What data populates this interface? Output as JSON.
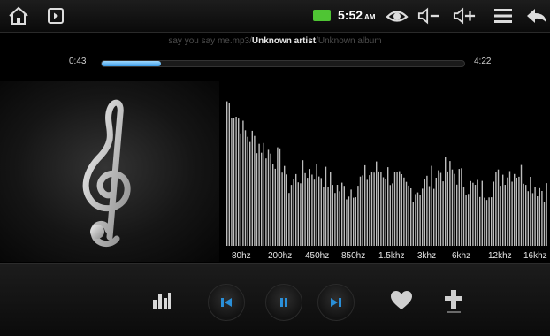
{
  "status_bar": {
    "time": "5:52",
    "ampm": "AM",
    "icons": [
      "home-icon",
      "play-indicator-icon",
      "battery-icon",
      "eye-icon",
      "volume-down-icon",
      "volume-up-icon",
      "menu-icon",
      "back-icon"
    ],
    "battery_color": "#4fc534"
  },
  "now_playing": {
    "title": "say you say me.mp3",
    "separator": "/",
    "artist": "Unknown artist",
    "album": "Unknown album",
    "elapsed": "0:43",
    "duration": "4:22",
    "progress_fraction": 0.164,
    "progress_color": "#3a9be6"
  },
  "album_art": {
    "icon": "treble-clef-icon"
  },
  "equalizer": {
    "frequency_labels": [
      "80hz",
      "200hz",
      "450hz",
      "850hz",
      "1.5khz",
      "3khz",
      "6khz",
      "12khz",
      "16khz"
    ],
    "bar_color": "#bdbdbd"
  },
  "controls": {
    "icons": [
      "equalizer-icon",
      "previous-icon",
      "pause-icon",
      "next-icon",
      "heart-icon",
      "add-icon"
    ],
    "accent_color": "#2a8fd8"
  }
}
